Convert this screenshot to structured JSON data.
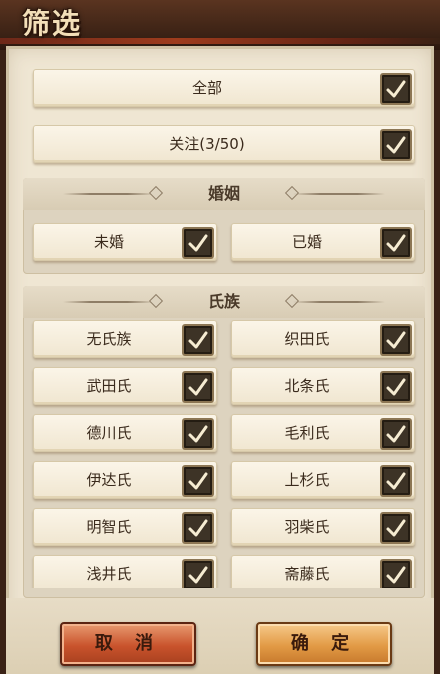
{
  "window": {
    "title": "筛选"
  },
  "filters": {
    "all": {
      "label": "全部",
      "checked": true
    },
    "follow": {
      "label": "关注(3/50)",
      "checked": true
    }
  },
  "marriage": {
    "title": "婚姻",
    "items": [
      {
        "label": "未婚",
        "checked": true
      },
      {
        "label": "已婚",
        "checked": true
      }
    ]
  },
  "clan": {
    "title": "氏族",
    "items": [
      {
        "label": "无氏族",
        "checked": true
      },
      {
        "label": "织田氏",
        "checked": true
      },
      {
        "label": "武田氏",
        "checked": true
      },
      {
        "label": "北条氏",
        "checked": true
      },
      {
        "label": "德川氏",
        "checked": true
      },
      {
        "label": "毛利氏",
        "checked": true
      },
      {
        "label": "伊达氏",
        "checked": true
      },
      {
        "label": "上杉氏",
        "checked": true
      },
      {
        "label": "明智氏",
        "checked": true
      },
      {
        "label": "羽柴氏",
        "checked": true
      },
      {
        "label": "浅井氏",
        "checked": true
      },
      {
        "label": "斋藤氏",
        "checked": true
      }
    ]
  },
  "actions": {
    "cancel_label": "取 消",
    "confirm_label": "确 定"
  },
  "colors": {
    "accent_cancel": "#c9532c",
    "accent_confirm": "#e29a45",
    "checkbox_bg": "#3d3326"
  }
}
